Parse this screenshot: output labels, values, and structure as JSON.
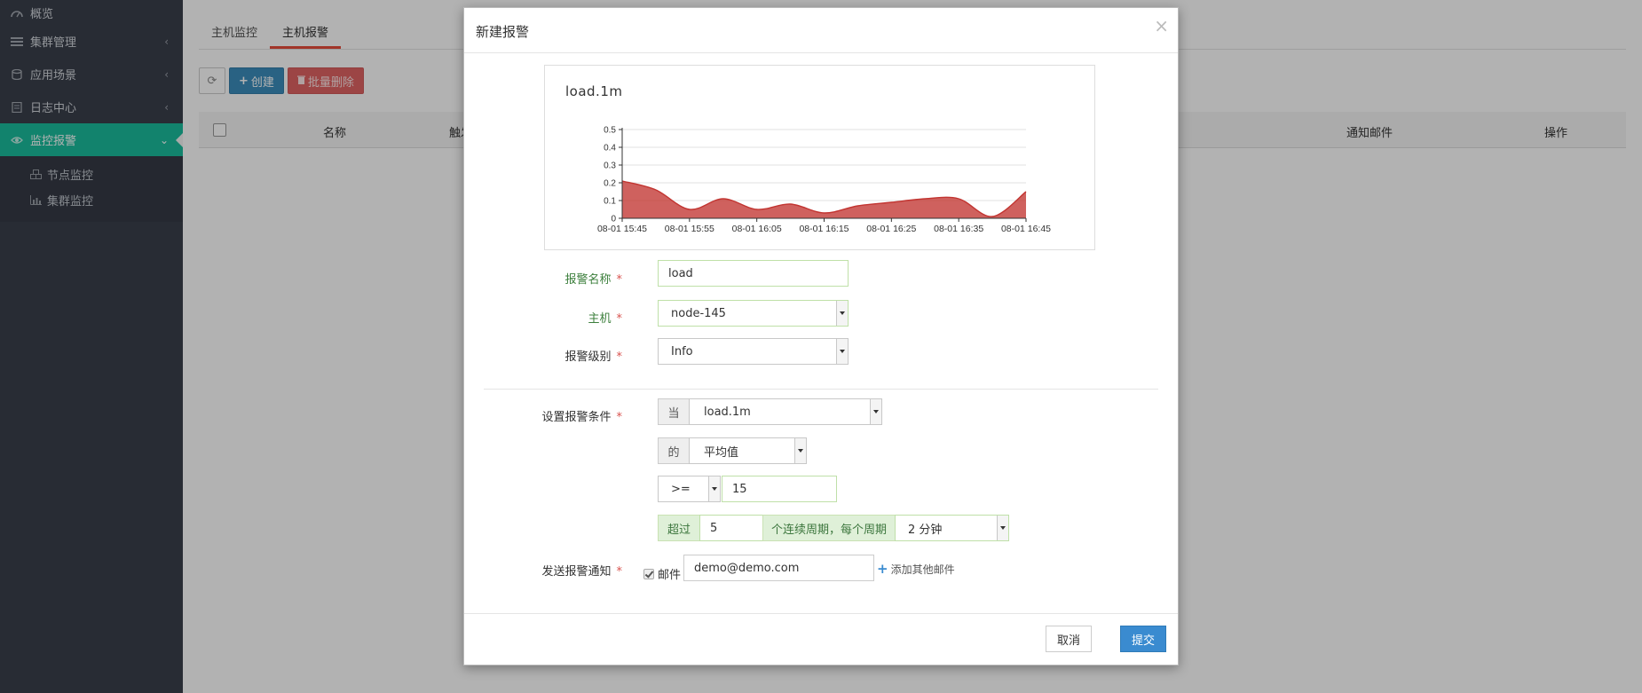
{
  "sidebar": {
    "items": [
      {
        "label": "概览"
      },
      {
        "label": "集群管理"
      },
      {
        "label": "应用场景"
      },
      {
        "label": "日志中心"
      },
      {
        "label": "监控报警"
      }
    ],
    "sub_items": [
      {
        "label": "节点监控"
      },
      {
        "label": "集群监控"
      }
    ]
  },
  "tabs": [
    {
      "label": "主机监控"
    },
    {
      "label": "主机报警"
    }
  ],
  "toolbar": {
    "create_label": "创建",
    "batch_delete_label": "批量删除"
  },
  "table": {
    "columns": [
      "名称",
      "触发",
      "通知邮件",
      "操作"
    ]
  },
  "modal": {
    "title": "新建报警",
    "close_icon": "×",
    "form": {
      "alarm_name_label": "报警名称",
      "alarm_name_value": "load",
      "host_label": "主机",
      "host_value": "node-145",
      "level_label": "报警级别",
      "level_value": "Info",
      "condition_label": "设置报警条件",
      "when_addon": "当",
      "metric_value": "load.1m",
      "of_addon": "的",
      "aggregate_value": "平均值",
      "operator_value": ">=",
      "threshold_value": "15",
      "exceed_addon": "超过",
      "periods_value": "5",
      "period_text_addon": "个连续周期，每个周期",
      "period_value": "2 分钟",
      "notify_label": "发送报警通知",
      "email_checkbox_label": "邮件",
      "email_value": "demo@demo.com",
      "add_email_label": "添加其他邮件",
      "required_mark": "*"
    },
    "footer": {
      "cancel_label": "取消",
      "submit_label": "提交"
    }
  },
  "chart_data": {
    "type": "area",
    "title": "load.1m",
    "x": [
      "08-01 15:45",
      "08-01 15:55",
      "08-01 16:05",
      "08-01 16:15",
      "08-01 16:25",
      "08-01 16:35",
      "08-01 16:45"
    ],
    "y_ticks": [
      "0",
      "0.1",
      "0.2",
      "0.3",
      "0.4",
      "0.5"
    ],
    "ylim": [
      0,
      0.5
    ],
    "series": [
      {
        "values": [
          0.21,
          0.16,
          0.05,
          0.11,
          0.05,
          0.08,
          0.03,
          0.07,
          0.09,
          0.11,
          0.11,
          0.01,
          0.15
        ],
        "color": "#c23531"
      }
    ],
    "grid": true
  }
}
